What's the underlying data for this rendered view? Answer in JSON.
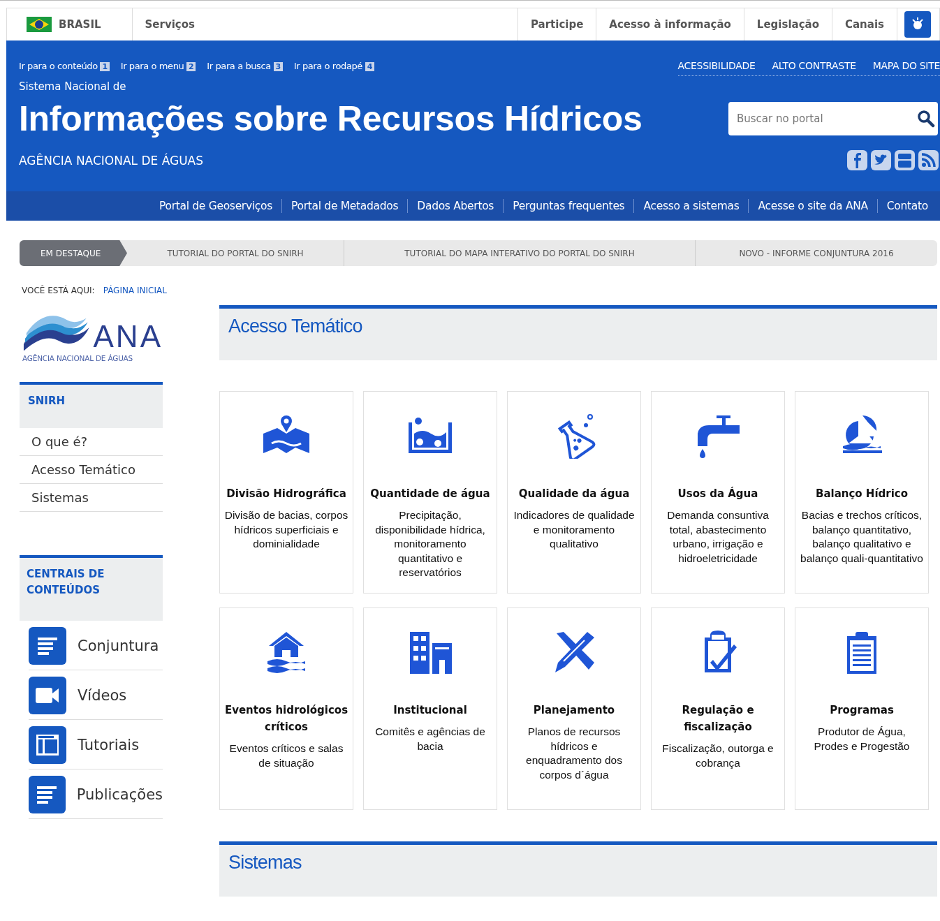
{
  "gov_bar": {
    "country": "BRASIL",
    "left_links": [
      "Serviços"
    ],
    "right_links": [
      "Participe",
      "Acesso à informação",
      "Legislação",
      "Canais"
    ]
  },
  "header": {
    "skip_links": [
      {
        "label": "Ir para o conteúdo",
        "key": "1"
      },
      {
        "label": "Ir para o menu",
        "key": "2"
      },
      {
        "label": "Ir para a busca",
        "key": "3"
      },
      {
        "label": "Ir para o rodapé",
        "key": "4"
      }
    ],
    "util_links": [
      "ACESSIBILIDADE",
      "ALTO CONTRASTE",
      "MAPA DO SITE"
    ],
    "subtitle": "Sistema Nacional de",
    "title": "Informações sobre Recursos Hídricos",
    "agency": "AGÊNCIA NACIONAL DE ÁGUAS",
    "search": {
      "placeholder": "Buscar no portal"
    }
  },
  "nav": [
    "Portal de Geoserviços",
    "Portal de Metadados",
    "Dados Abertos",
    "Perguntas frequentes",
    "Acesso a sistemas",
    "Acesse o site da ANA",
    "Contato"
  ],
  "highlights": {
    "label": "EM DESTAQUE",
    "items": [
      "TUTORIAL DO PORTAL DO SNIRH",
      "TUTORIAL DO MAPA INTERATIVO DO PORTAL DO SNIRH",
      "NOVO - INFORME CONJUNTURA 2016"
    ]
  },
  "breadcrumb": {
    "label": "VOCÊ ESTÁ AQUI:",
    "current": "PÁGINA INICIAL"
  },
  "logo": {
    "name": "ANA",
    "tagline": "AGÊNCIA NACIONAL DE ÁGUAS"
  },
  "sidebar": {
    "menu_title": "SNIRH",
    "menu": [
      "O que é?",
      "Acesso Temático",
      "Sistemas"
    ],
    "content_title": "CENTRAIS DE CONTEÚDOS",
    "content": [
      {
        "label": "Conjuntura",
        "kind": "text"
      },
      {
        "label": "Vídeos",
        "kind": "video"
      },
      {
        "label": "Tutoriais",
        "kind": "layout"
      },
      {
        "label": "Publicações",
        "kind": "text"
      }
    ]
  },
  "sections": [
    {
      "title": "Acesso Temático"
    },
    {
      "title": "Sistemas"
    }
  ],
  "cards": [
    {
      "title": "Divisão Hidrográfica",
      "text": "Divisão de bacias, corpos hídricos superficiais e dominialidade"
    },
    {
      "title": "Quantidade de água",
      "text": "Precipitação, disponibilidade hídrica, monitoramento quantitativo e reservatórios"
    },
    {
      "title": "Qualidade da água",
      "text": "Indicadores de qualidade e monitoramento qualitativo"
    },
    {
      "title": "Usos da Água",
      "text": "Demanda consuntiva total, abastecimento urbano, irrigação e hidroeletricidade"
    },
    {
      "title": "Balanço Hídrico",
      "text": "Bacias e trechos críticos, balanço quantitativo, balanço qualitativo e balanço quali-quantitativo"
    },
    {
      "title": "Eventos hidrológicos críticos",
      "text": "Eventos críticos e salas de situação"
    },
    {
      "title": "Institucional",
      "text": "Comitês e agências de bacia"
    },
    {
      "title": "Planejamento",
      "text": "Planos de recursos hídricos e enquadramento dos corpos d´água"
    },
    {
      "title": "Regulação e fiscalização",
      "text": "Fiscalização, outorga e cobrança"
    },
    {
      "title": "Programas",
      "text": "Produtor de Água, Prodes e Progestão"
    }
  ]
}
